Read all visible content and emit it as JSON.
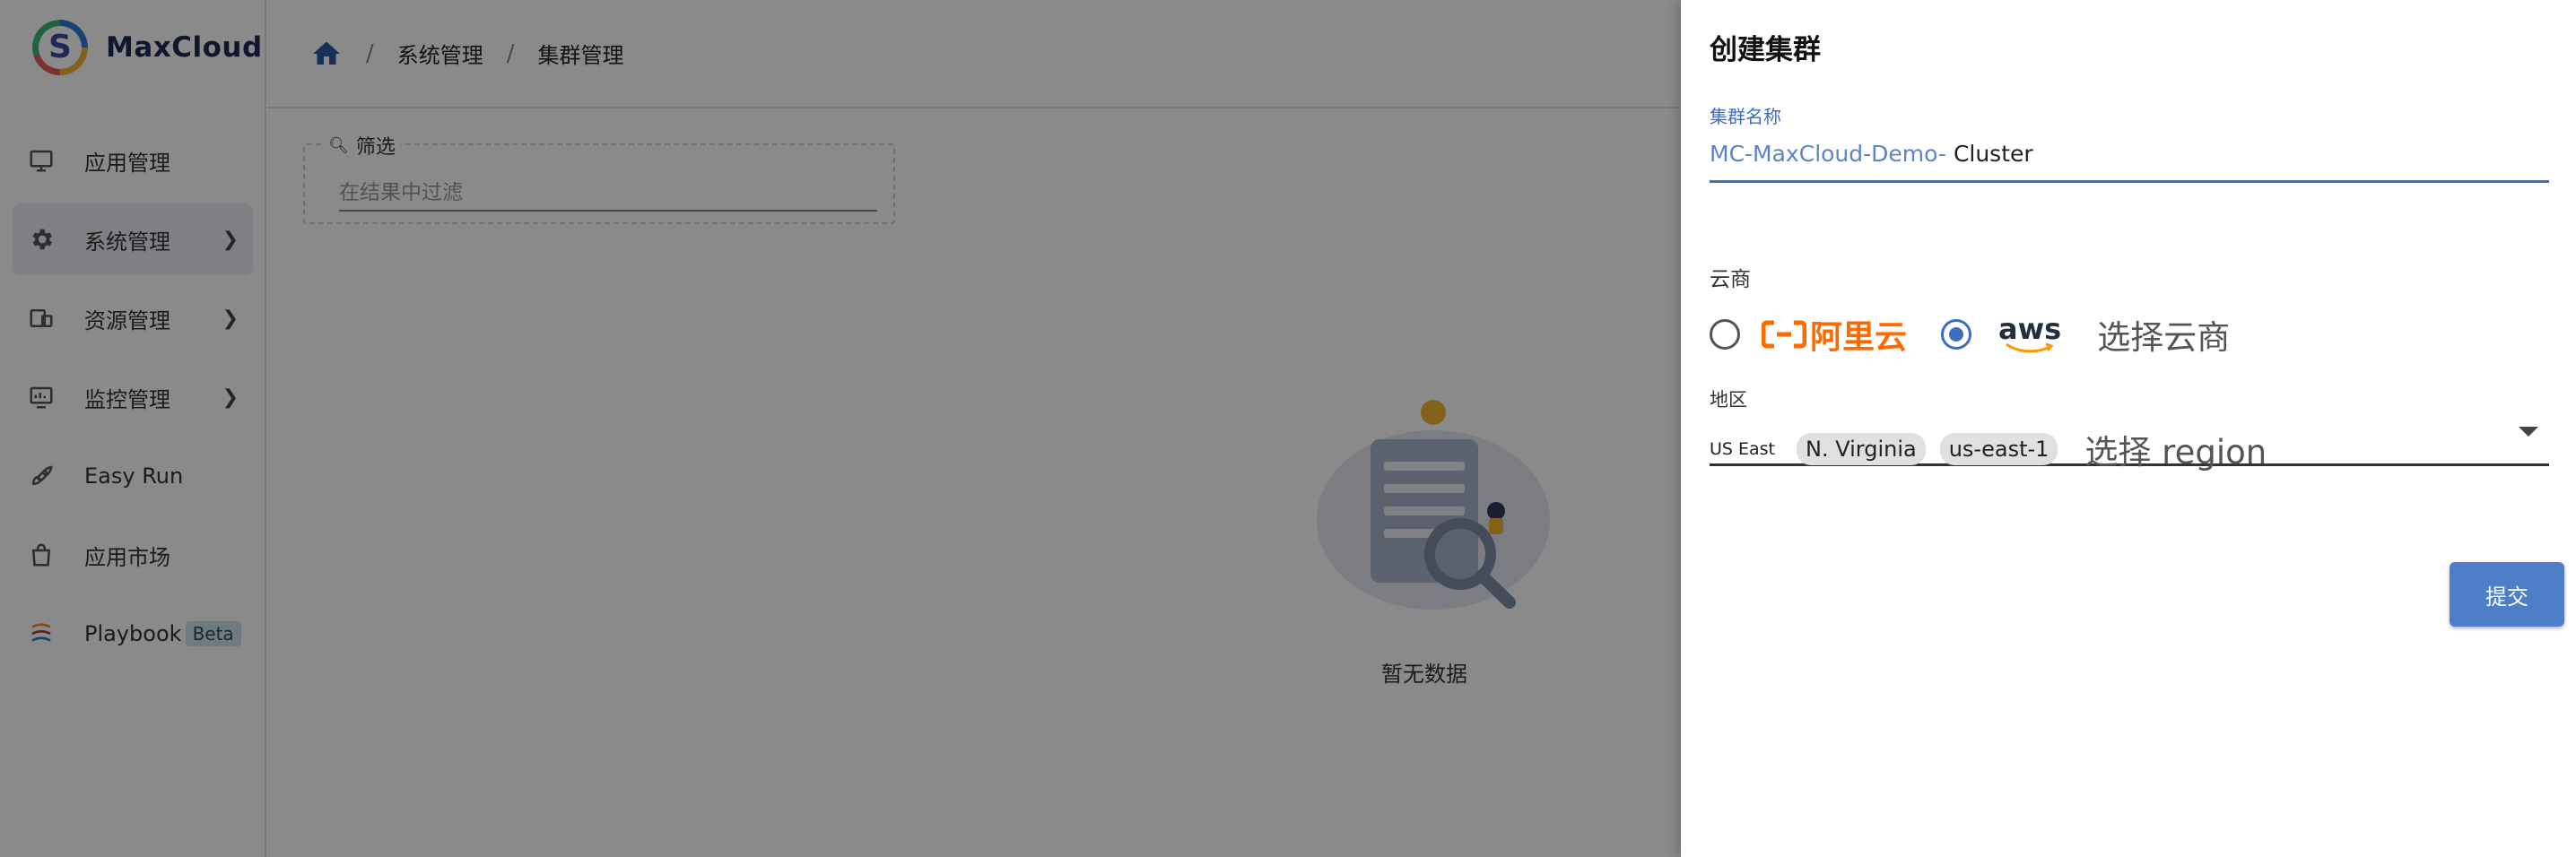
{
  "app": {
    "name": "MaxCloud",
    "logo_letter": "S"
  },
  "sidebar": {
    "items": [
      {
        "label": "应用管理",
        "icon": "monitor-icon",
        "has_chevron": false
      },
      {
        "label": "系统管理",
        "icon": "gear-icon",
        "has_chevron": true,
        "active": true
      },
      {
        "label": "资源管理",
        "icon": "devices-icon",
        "has_chevron": true
      },
      {
        "label": "监控管理",
        "icon": "monitor-chart-icon",
        "has_chevron": true
      },
      {
        "label": "Easy Run",
        "icon": "rocket-icon",
        "has_chevron": false
      },
      {
        "label": "应用市场",
        "icon": "shopping-bag-icon",
        "has_chevron": false
      },
      {
        "label": "Playbook",
        "icon": "playbook-icon",
        "has_chevron": false,
        "badge": "Beta"
      }
    ]
  },
  "breadcrumb": {
    "items": [
      "系统管理",
      "集群管理"
    ],
    "separator": "/"
  },
  "filter": {
    "legend": "筛选",
    "placeholder": "在结果中过滤"
  },
  "empty_state": {
    "text": "暂无数据"
  },
  "drawer": {
    "title": "创建集群",
    "cluster_name": {
      "label": "集群名称",
      "prefix": "MC-MaxCloud-Demo-",
      "value": "Cluster"
    },
    "cloud": {
      "label": "云商",
      "options": [
        {
          "name": "阿里云",
          "checked": false
        },
        {
          "name": "aws",
          "checked": true
        }
      ],
      "hint": "选择云商"
    },
    "region": {
      "label": "地区",
      "prefix": "US East",
      "chips": [
        "N. Virginia",
        "us-east-1"
      ],
      "hint": "选择 region"
    },
    "submit_label": "提交"
  },
  "colors": {
    "accent": "#3e6ec0",
    "aliyun": "#ff6a00",
    "submit": "#4f7ec8",
    "overlay": "rgba(0,0,0,0.46)"
  }
}
